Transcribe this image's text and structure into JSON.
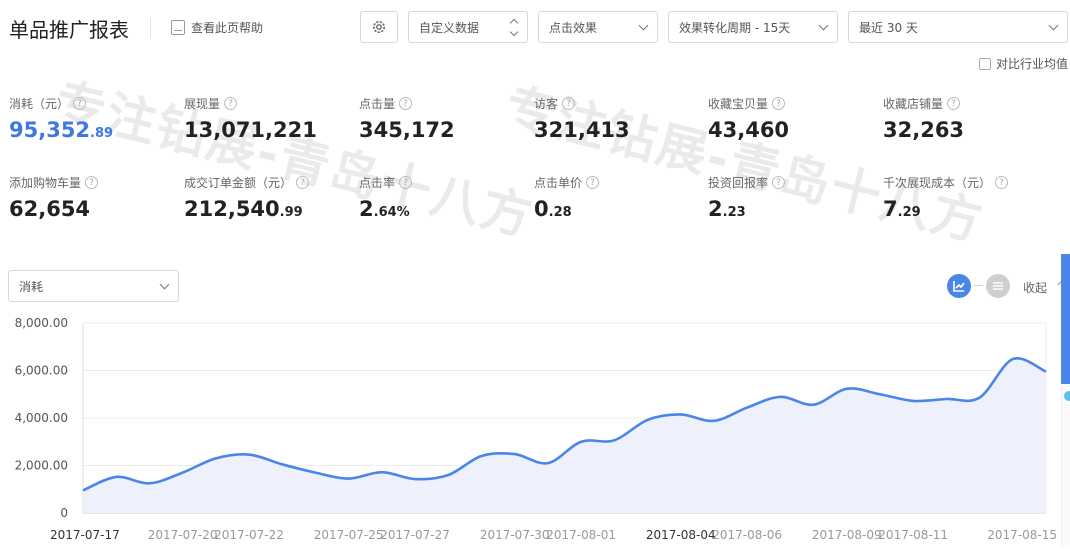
{
  "header": {
    "title": "单品推广报表",
    "help_label": "查看此页帮助",
    "custom_data_label": "自定义数据",
    "click_effect_label": "点击效果",
    "conversion_period_label": "效果转化周期 - 15天",
    "date_range_label": "最近 30 天",
    "compare_label": "对比行业均值"
  },
  "watermark": [
    "专注钻展-青岛十八方",
    "专注钻展-青岛十八方"
  ],
  "metrics": [
    {
      "label": "消耗（元）",
      "int": "95,352",
      "dec": ".89",
      "highlight": true
    },
    {
      "label": "展现量",
      "int": "13,071,221",
      "dec": ""
    },
    {
      "label": "点击量",
      "int": "345,172",
      "dec": ""
    },
    {
      "label": "访客",
      "int": "321,413",
      "dec": ""
    },
    {
      "label": "收藏宝贝量",
      "int": "43,460",
      "dec": ""
    },
    {
      "label": "收藏店铺量",
      "int": "32,263",
      "dec": ""
    },
    {
      "label": "添加购物车量",
      "int": "62,654",
      "dec": ""
    },
    {
      "label": "成交订单金额（元）",
      "int": "212,540",
      "dec": ".99"
    },
    {
      "label": "点击率",
      "int": "2",
      "dec": ".64%"
    },
    {
      "label": "点击单价",
      "int": "0",
      "dec": ".28"
    },
    {
      "label": "投资回报率",
      "int": "2",
      "dec": ".23"
    },
    {
      "label": "千次展现成本（元）",
      "int": "7",
      "dec": ".29"
    }
  ],
  "chart_controls": {
    "metric_select_value": "消耗",
    "collapse_label": "收起",
    "active_color": "#4a86e8"
  },
  "chart_data": {
    "type": "area",
    "series": [
      {
        "values": [
          950,
          1520,
          1250,
          1700,
          2300,
          2460,
          2050,
          1700,
          1450,
          1720,
          1430,
          1600,
          2400,
          2480,
          2100,
          3000,
          3060,
          3920,
          4150,
          3880,
          4440,
          4890,
          4560,
          5230,
          5000,
          4720,
          4800,
          4860,
          6480,
          5950
        ]
      }
    ],
    "x": [
      "2017-07-17",
      "2017-07-18",
      "2017-07-19",
      "2017-07-20",
      "2017-07-21",
      "2017-07-22",
      "2017-07-23",
      "2017-07-24",
      "2017-07-25",
      "2017-07-26",
      "2017-07-27",
      "2017-07-28",
      "2017-07-29",
      "2017-07-30",
      "2017-07-31",
      "2017-08-01",
      "2017-08-02",
      "2017-08-03",
      "2017-08-04",
      "2017-08-05",
      "2017-08-06",
      "2017-08-07",
      "2017-08-08",
      "2017-08-09",
      "2017-08-10",
      "2017-08-11",
      "2017-08-12",
      "2017-08-13",
      "2017-08-14",
      "2017-08-15"
    ],
    "tick_labels": [
      {
        "label": "2017-07-17",
        "dark": true
      },
      {
        "label": "2017-07-20",
        "dark": false
      },
      {
        "label": "2017-07-22",
        "dark": false
      },
      {
        "label": "2017-07-25",
        "dark": false
      },
      {
        "label": "2017-07-27",
        "dark": false
      },
      {
        "label": "2017-07-30",
        "dark": false
      },
      {
        "label": "2017-08-01",
        "dark": false
      },
      {
        "label": "2017-08-04",
        "dark": true
      },
      {
        "label": "2017-08-06",
        "dark": false
      },
      {
        "label": "2017-08-09",
        "dark": false
      },
      {
        "label": "2017-08-11",
        "dark": false
      },
      {
        "label": "2017-08-15",
        "dark": false
      }
    ],
    "y_ticks": [
      "8,000.00",
      "6,000.00",
      "4,000.00",
      "2,000.00",
      "0"
    ],
    "ylim": [
      0,
      8000
    ],
    "grid": true,
    "line_color": "#4a86e8",
    "fill_color": "#eef1fb"
  }
}
